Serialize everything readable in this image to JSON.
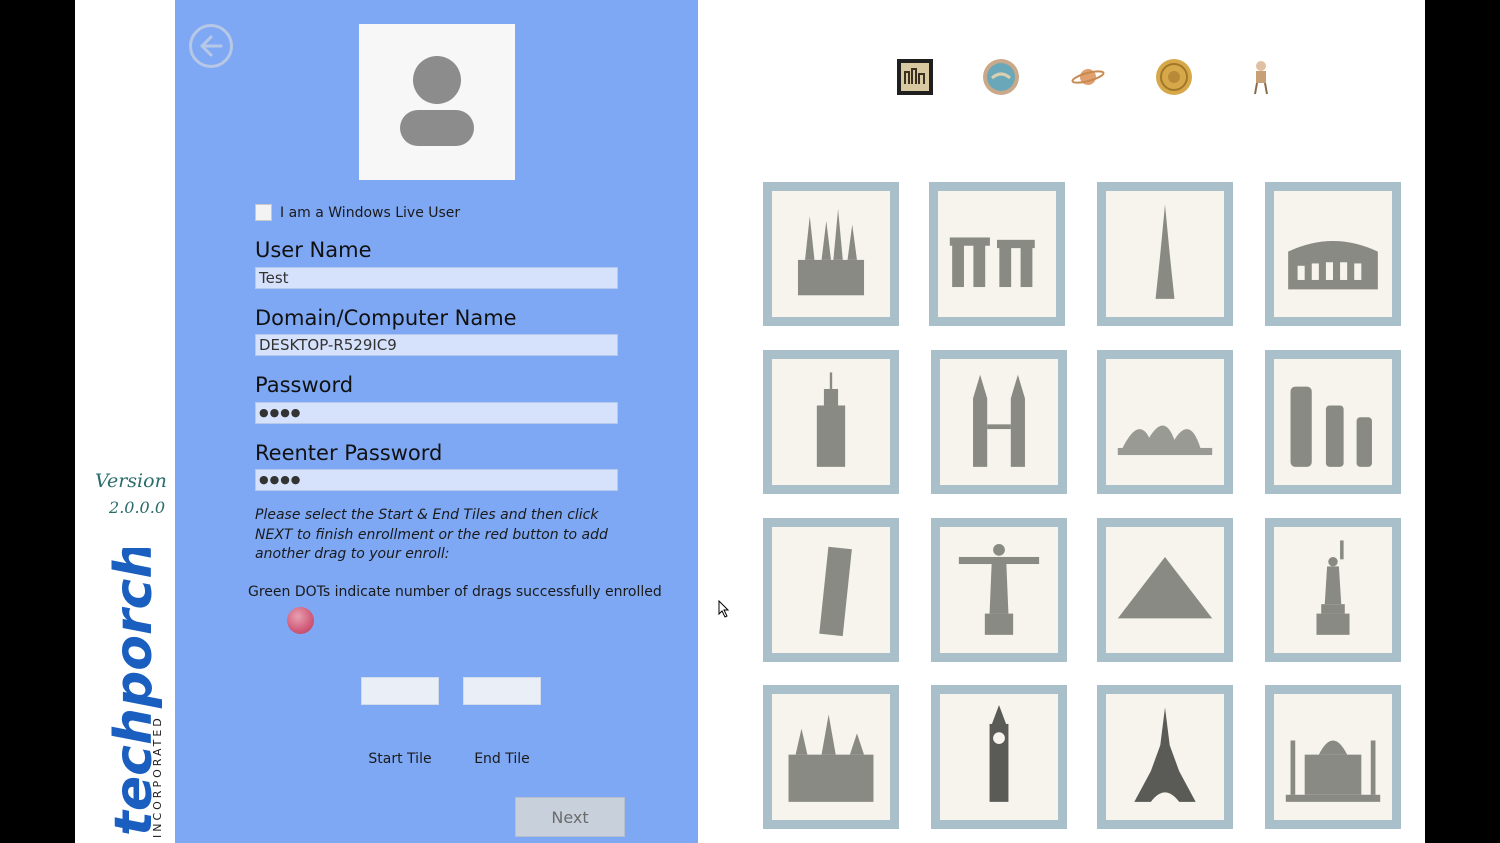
{
  "brand": {
    "version_label": "Version",
    "version_number": "2.0.0.0",
    "logo_main": "techporch",
    "logo_sub": "INCORPORATED"
  },
  "form": {
    "windows_live_label": "I am a Windows Live User",
    "user_name_label": "User Name",
    "user_name_value": "Test",
    "domain_label": "Domain/Computer Name",
    "domain_value": "DESKTOP-R529IC9",
    "password_label": "Password",
    "password_value": "●●●●",
    "reenter_label": "Reenter Password",
    "reenter_value": "●●●●",
    "instructions": "Please select the Start & End Tiles and then click NEXT to finish enrollment or the red button to add another drag to your enroll:",
    "dots_note": "Green DOTs indicate number of drags successfully enrolled",
    "start_tile_label": "Start Tile",
    "end_tile_label": "End Tile",
    "next_label": "Next"
  },
  "colors": {
    "panel": "#7fa8f4",
    "tile_frame": "#a9bfc9",
    "tile_bg": "#f6f4ec",
    "accent_red": "#d05a78"
  },
  "tabs": [
    {
      "name": "image-set-tab-1-icon",
      "selected": true
    },
    {
      "name": "image-set-tab-2-icon",
      "selected": false
    },
    {
      "name": "image-set-tab-3-icon",
      "selected": false
    },
    {
      "name": "image-set-tab-4-icon",
      "selected": false
    },
    {
      "name": "image-set-tab-5-icon",
      "selected": false
    }
  ],
  "tiles": [
    {
      "name": "tile-cathedral",
      "icon": "cathedral-icon"
    },
    {
      "name": "tile-stonehenge",
      "icon": "stonehenge-icon"
    },
    {
      "name": "tile-burj-khalifa",
      "icon": "tower-spire-icon"
    },
    {
      "name": "tile-colosseum",
      "icon": "colosseum-icon"
    },
    {
      "name": "tile-empire-state",
      "icon": "skyscraper-icon"
    },
    {
      "name": "tile-petronas",
      "icon": "twin-towers-icon"
    },
    {
      "name": "tile-sydney-opera",
      "icon": "opera-house-icon"
    },
    {
      "name": "tile-moai",
      "icon": "moai-icon"
    },
    {
      "name": "tile-pisa",
      "icon": "leaning-tower-icon"
    },
    {
      "name": "tile-christ-redeemer",
      "icon": "statue-icon"
    },
    {
      "name": "tile-pyramid",
      "icon": "pyramid-icon"
    },
    {
      "name": "tile-liberty",
      "icon": "liberty-statue-icon"
    },
    {
      "name": "tile-castle",
      "icon": "castle-icon"
    },
    {
      "name": "tile-big-ben",
      "icon": "clock-tower-icon"
    },
    {
      "name": "tile-eiffel",
      "icon": "eiffel-tower-icon"
    },
    {
      "name": "tile-taj-mahal",
      "icon": "taj-mahal-icon"
    }
  ]
}
